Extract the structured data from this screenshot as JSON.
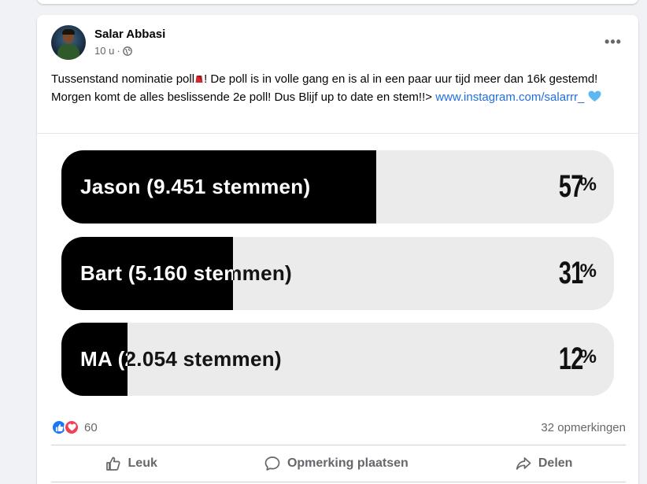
{
  "post": {
    "author": "Salar Abbasi",
    "time": "10 u",
    "more_label": "•••",
    "text_part1": "Tussenstand nominatie poll",
    "text_part2": "! De poll is in volle gang en is al in een paar uur tijd meer dan 16k gestemd! Morgen komt de alles beslissende 2e poll! Dus Blijf up to date en stem!!> ",
    "link": "www.instagram.com/salarrr_"
  },
  "poll": {
    "options": [
      {
        "label": "Jason (9.451 stemmen)",
        "percent_num": "57",
        "percent_sym": "%",
        "fill": 0.57
      },
      {
        "label": "Bart (5.160 stemmen)",
        "percent_num": "31",
        "percent_sym": "%",
        "fill": 0.31
      },
      {
        "label": "MA (2.054 stemmen)",
        "percent_num": "12",
        "percent_sym": "%",
        "fill": 0.12
      }
    ]
  },
  "stats": {
    "reaction_count": "60",
    "comments": "32 opmerkingen"
  },
  "actions": {
    "like": "Leuk",
    "comment": "Opmerking plaatsen",
    "share": "Delen"
  },
  "colors": {
    "link": "#216fdb",
    "like_blue": "#1877f2",
    "love_red": "#f33e58"
  },
  "icons": [
    "globe-icon",
    "more-icon",
    "fez-emoji-icon",
    "blue-heart-icon",
    "like-reaction-icon",
    "love-reaction-icon",
    "thumbs-up-icon",
    "comment-icon",
    "share-icon"
  ]
}
